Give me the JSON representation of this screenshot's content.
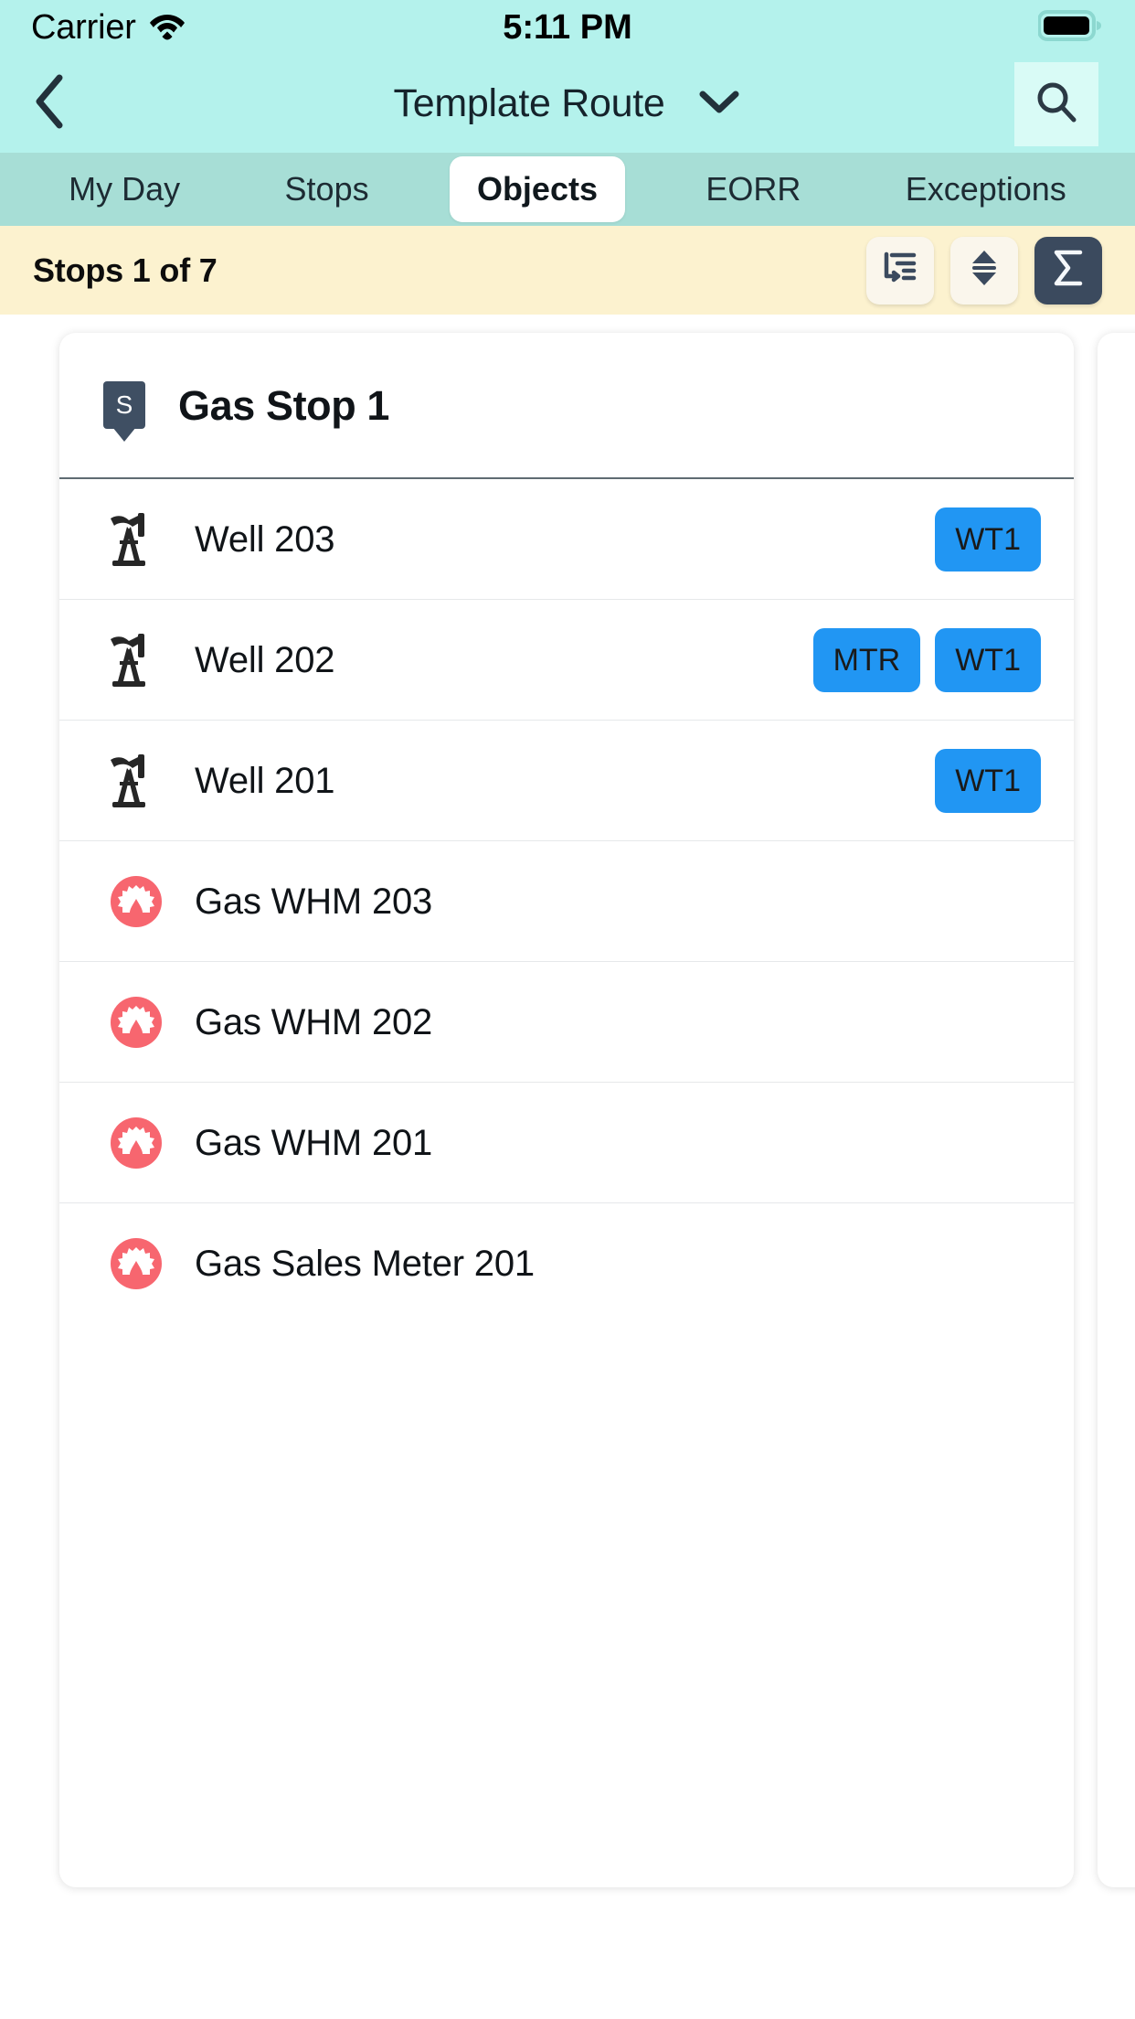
{
  "status_bar": {
    "carrier": "Carrier",
    "time": "5:11 PM",
    "wifi_icon": "wifi-icon",
    "battery_icon": "battery-full-icon"
  },
  "nav_bar": {
    "back_icon": "chevron-left-icon",
    "title": "Template Route",
    "dropdown_icon": "chevron-down-icon",
    "search_icon": "search-icon"
  },
  "tabs": [
    {
      "label": "My Day",
      "active": false
    },
    {
      "label": "Stops",
      "active": false
    },
    {
      "label": "Objects",
      "active": true
    },
    {
      "label": "EORR",
      "active": false
    },
    {
      "label": "Exceptions",
      "active": false
    }
  ],
  "sub_header": {
    "stops_count": "Stops 1 of 7",
    "actions": [
      {
        "name": "group-list-icon",
        "style": "light"
      },
      {
        "name": "sort-updown-icon",
        "style": "light"
      },
      {
        "name": "sigma-sum-icon",
        "style": "dark"
      }
    ]
  },
  "card": {
    "pin_letter": "S",
    "title": "Gas Stop 1",
    "objects": [
      {
        "icon": "pumpjack-icon",
        "label": "Well 203",
        "tags": [
          "WT1"
        ]
      },
      {
        "icon": "pumpjack-icon",
        "label": "Well 202",
        "tags": [
          "MTR",
          "WT1"
        ]
      },
      {
        "icon": "pumpjack-icon",
        "label": "Well 201",
        "tags": [
          "WT1"
        ]
      },
      {
        "icon": "wellhead-icon",
        "label": "Gas WHM 203",
        "tags": []
      },
      {
        "icon": "wellhead-icon",
        "label": "Gas WHM 202",
        "tags": []
      },
      {
        "icon": "wellhead-icon",
        "label": "Gas WHM 201",
        "tags": []
      },
      {
        "icon": "wellhead-icon",
        "label": "Gas Sales Meter 201",
        "tags": []
      }
    ]
  },
  "colors": {
    "header_bg": "#b4f2ec",
    "tabbar_bg": "#a7ded6",
    "subheader_bg": "#fcf2cf",
    "tag_blue": "#2196f3",
    "icon_red": "#f7666f",
    "dark_slate": "#3b4a5e"
  }
}
